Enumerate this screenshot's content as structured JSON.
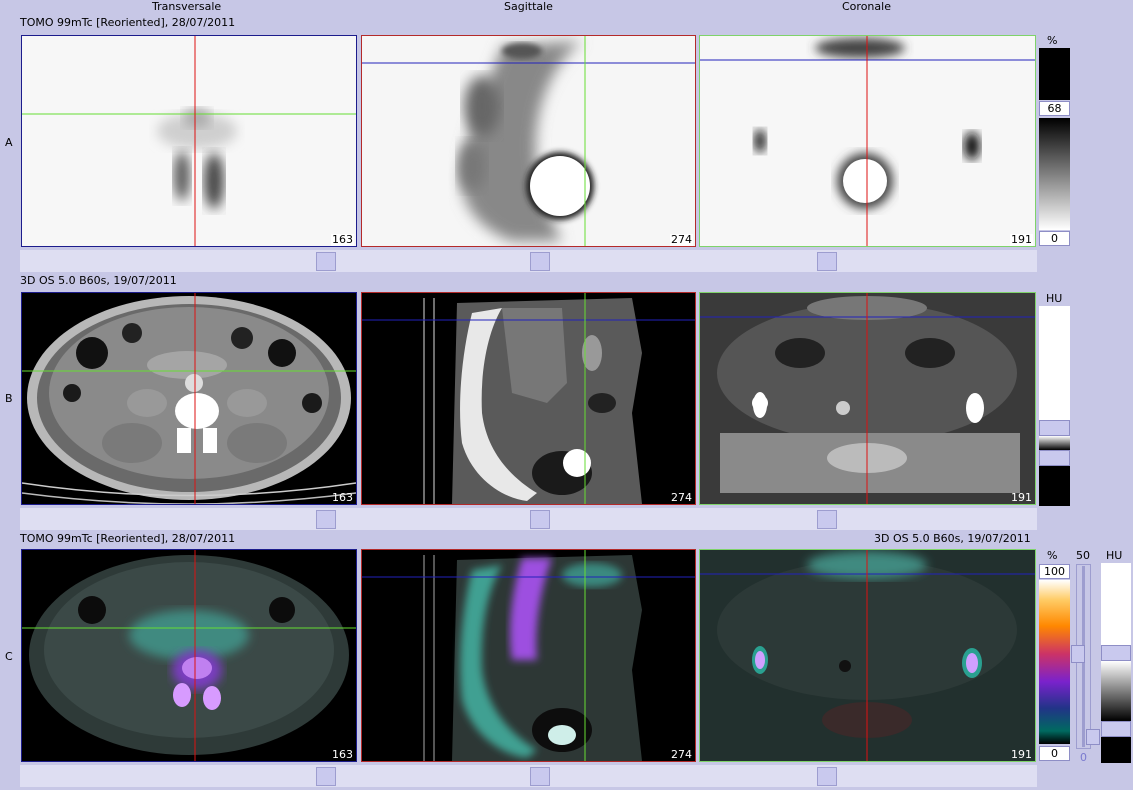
{
  "headers": {
    "col1": "Transversale",
    "col2": "Sagittale",
    "col3": "Coronale"
  },
  "rows": {
    "a": {
      "label": "A",
      "caption_left": "TOMO 99mTc [Reoriented], 28/07/2011"
    },
    "b": {
      "label": "B",
      "caption_left": "3D  OS  5.0  B60s, 19/07/2011"
    },
    "c": {
      "label": "C",
      "caption_left": "TOMO 99mTc [Reoriented], 28/07/2011",
      "caption_right": "3D  OS  5.0  B60s, 19/07/2011"
    }
  },
  "slices": {
    "transversal": "163",
    "sagittal": "274",
    "coronal": "191"
  },
  "colorbars": {
    "a": {
      "unit": "%",
      "level": "68",
      "min": "0"
    },
    "b": {
      "unit": "HU"
    },
    "c": {
      "unit_pct": "%",
      "unit_hu": "HU",
      "max": "100",
      "min": "0",
      "slider_top": "50",
      "slider_bottom": "0"
    }
  },
  "colors": {
    "background": "#c7c7e6",
    "frame_transversal": "#1c1c8c",
    "frame_sagittal": "#b42a2a",
    "frame_coronal": "#7fd36a",
    "crosshair_red": "#dd1111",
    "crosshair_green": "#66dd33",
    "crosshair_blue": "#2222bb"
  }
}
